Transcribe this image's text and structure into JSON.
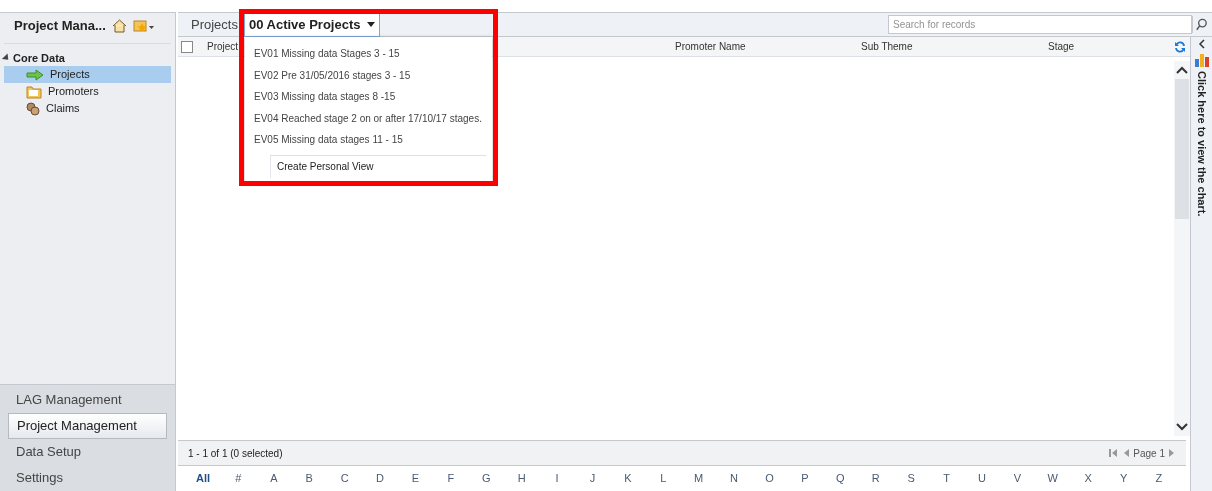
{
  "sidebar": {
    "title": "Project Mana...",
    "group": {
      "label": "Core Data",
      "expanded": true
    },
    "items": [
      {
        "label": "Projects",
        "kind": "arrow",
        "selected": true
      },
      {
        "label": "Promoters",
        "kind": "folder",
        "selected": false
      },
      {
        "label": "Claims",
        "kind": "coins",
        "selected": false
      }
    ],
    "areas": [
      {
        "label": "LAG Management",
        "selected": false
      },
      {
        "label": "Project Management",
        "selected": true
      },
      {
        "label": "Data Setup",
        "selected": false
      },
      {
        "label": "Settings",
        "selected": false
      }
    ]
  },
  "toolbar": {
    "entity": "Projects",
    "view": "00 Active Projects",
    "search": {
      "placeholder": "Search for records"
    }
  },
  "view_menu": {
    "items": [
      "EV01 Missing data Stages 3 - 15",
      "EV02 Pre 31/05/2016 stages 3 - 15",
      "EV03 Missing data stages 8 -15",
      "EV04 Reached stage 2 on or after 17/10/17 stages.",
      "EV05 Missing data stages 11 - 15"
    ],
    "action": "Create Personal View"
  },
  "table": {
    "columns": [
      "Project",
      "Promoter Name",
      "Sub Theme",
      "Stage"
    ],
    "select_all": {
      "checked": false
    }
  },
  "status_bar": {
    "count": "1 - 1 of 1 (0 selected)",
    "page": "Page 1"
  },
  "index": [
    {
      "label": "All",
      "selected": true
    },
    {
      "label": "#",
      "selected": false
    },
    {
      "label": "A",
      "selected": false
    },
    {
      "label": "B",
      "selected": false
    },
    {
      "label": "C",
      "selected": false
    },
    {
      "label": "D",
      "selected": false
    },
    {
      "label": "E",
      "selected": false
    },
    {
      "label": "F",
      "selected": false
    },
    {
      "label": "G",
      "selected": false
    },
    {
      "label": "H",
      "selected": false
    },
    {
      "label": "I",
      "selected": false
    },
    {
      "label": "J",
      "selected": false
    },
    {
      "label": "K",
      "selected": false
    },
    {
      "label": "L",
      "selected": false
    },
    {
      "label": "M",
      "selected": false
    },
    {
      "label": "N",
      "selected": false
    },
    {
      "label": "O",
      "selected": false
    },
    {
      "label": "P",
      "selected": false
    },
    {
      "label": "Q",
      "selected": false
    },
    {
      "label": "R",
      "selected": false
    },
    {
      "label": "S",
      "selected": false
    },
    {
      "label": "T",
      "selected": false
    },
    {
      "label": "U",
      "selected": false
    },
    {
      "label": "V",
      "selected": false
    },
    {
      "label": "W",
      "selected": false
    },
    {
      "label": "X",
      "selected": false
    },
    {
      "label": "Y",
      "selected": false
    },
    {
      "label": "Z",
      "selected": false
    }
  ],
  "chart_pane": {
    "label": "Click here to view the chart."
  }
}
